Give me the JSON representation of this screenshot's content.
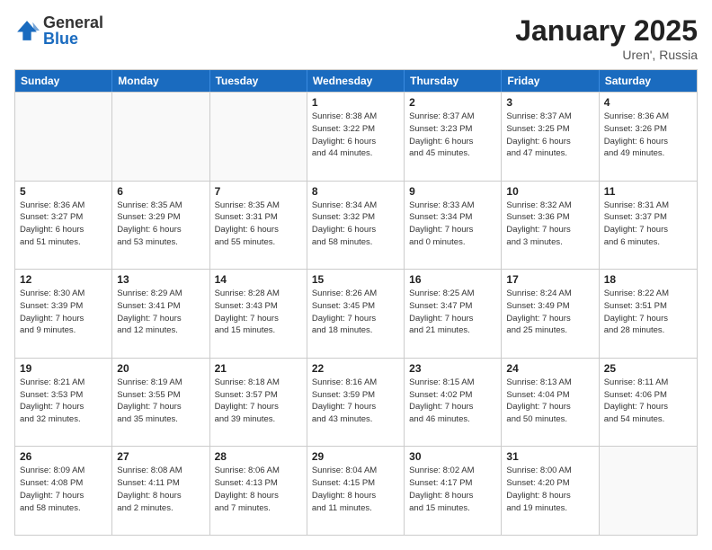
{
  "logo": {
    "general": "General",
    "blue": "Blue"
  },
  "header": {
    "month": "January 2025",
    "location": "Uren', Russia"
  },
  "weekdays": [
    "Sunday",
    "Monday",
    "Tuesday",
    "Wednesday",
    "Thursday",
    "Friday",
    "Saturday"
  ],
  "weeks": [
    [
      {
        "day": "",
        "info": ""
      },
      {
        "day": "",
        "info": ""
      },
      {
        "day": "",
        "info": ""
      },
      {
        "day": "1",
        "info": "Sunrise: 8:38 AM\nSunset: 3:22 PM\nDaylight: 6 hours\nand 44 minutes."
      },
      {
        "day": "2",
        "info": "Sunrise: 8:37 AM\nSunset: 3:23 PM\nDaylight: 6 hours\nand 45 minutes."
      },
      {
        "day": "3",
        "info": "Sunrise: 8:37 AM\nSunset: 3:25 PM\nDaylight: 6 hours\nand 47 minutes."
      },
      {
        "day": "4",
        "info": "Sunrise: 8:36 AM\nSunset: 3:26 PM\nDaylight: 6 hours\nand 49 minutes."
      }
    ],
    [
      {
        "day": "5",
        "info": "Sunrise: 8:36 AM\nSunset: 3:27 PM\nDaylight: 6 hours\nand 51 minutes."
      },
      {
        "day": "6",
        "info": "Sunrise: 8:35 AM\nSunset: 3:29 PM\nDaylight: 6 hours\nand 53 minutes."
      },
      {
        "day": "7",
        "info": "Sunrise: 8:35 AM\nSunset: 3:31 PM\nDaylight: 6 hours\nand 55 minutes."
      },
      {
        "day": "8",
        "info": "Sunrise: 8:34 AM\nSunset: 3:32 PM\nDaylight: 6 hours\nand 58 minutes."
      },
      {
        "day": "9",
        "info": "Sunrise: 8:33 AM\nSunset: 3:34 PM\nDaylight: 7 hours\nand 0 minutes."
      },
      {
        "day": "10",
        "info": "Sunrise: 8:32 AM\nSunset: 3:36 PM\nDaylight: 7 hours\nand 3 minutes."
      },
      {
        "day": "11",
        "info": "Sunrise: 8:31 AM\nSunset: 3:37 PM\nDaylight: 7 hours\nand 6 minutes."
      }
    ],
    [
      {
        "day": "12",
        "info": "Sunrise: 8:30 AM\nSunset: 3:39 PM\nDaylight: 7 hours\nand 9 minutes."
      },
      {
        "day": "13",
        "info": "Sunrise: 8:29 AM\nSunset: 3:41 PM\nDaylight: 7 hours\nand 12 minutes."
      },
      {
        "day": "14",
        "info": "Sunrise: 8:28 AM\nSunset: 3:43 PM\nDaylight: 7 hours\nand 15 minutes."
      },
      {
        "day": "15",
        "info": "Sunrise: 8:26 AM\nSunset: 3:45 PM\nDaylight: 7 hours\nand 18 minutes."
      },
      {
        "day": "16",
        "info": "Sunrise: 8:25 AM\nSunset: 3:47 PM\nDaylight: 7 hours\nand 21 minutes."
      },
      {
        "day": "17",
        "info": "Sunrise: 8:24 AM\nSunset: 3:49 PM\nDaylight: 7 hours\nand 25 minutes."
      },
      {
        "day": "18",
        "info": "Sunrise: 8:22 AM\nSunset: 3:51 PM\nDaylight: 7 hours\nand 28 minutes."
      }
    ],
    [
      {
        "day": "19",
        "info": "Sunrise: 8:21 AM\nSunset: 3:53 PM\nDaylight: 7 hours\nand 32 minutes."
      },
      {
        "day": "20",
        "info": "Sunrise: 8:19 AM\nSunset: 3:55 PM\nDaylight: 7 hours\nand 35 minutes."
      },
      {
        "day": "21",
        "info": "Sunrise: 8:18 AM\nSunset: 3:57 PM\nDaylight: 7 hours\nand 39 minutes."
      },
      {
        "day": "22",
        "info": "Sunrise: 8:16 AM\nSunset: 3:59 PM\nDaylight: 7 hours\nand 43 minutes."
      },
      {
        "day": "23",
        "info": "Sunrise: 8:15 AM\nSunset: 4:02 PM\nDaylight: 7 hours\nand 46 minutes."
      },
      {
        "day": "24",
        "info": "Sunrise: 8:13 AM\nSunset: 4:04 PM\nDaylight: 7 hours\nand 50 minutes."
      },
      {
        "day": "25",
        "info": "Sunrise: 8:11 AM\nSunset: 4:06 PM\nDaylight: 7 hours\nand 54 minutes."
      }
    ],
    [
      {
        "day": "26",
        "info": "Sunrise: 8:09 AM\nSunset: 4:08 PM\nDaylight: 7 hours\nand 58 minutes."
      },
      {
        "day": "27",
        "info": "Sunrise: 8:08 AM\nSunset: 4:11 PM\nDaylight: 8 hours\nand 2 minutes."
      },
      {
        "day": "28",
        "info": "Sunrise: 8:06 AM\nSunset: 4:13 PM\nDaylight: 8 hours\nand 7 minutes."
      },
      {
        "day": "29",
        "info": "Sunrise: 8:04 AM\nSunset: 4:15 PM\nDaylight: 8 hours\nand 11 minutes."
      },
      {
        "day": "30",
        "info": "Sunrise: 8:02 AM\nSunset: 4:17 PM\nDaylight: 8 hours\nand 15 minutes."
      },
      {
        "day": "31",
        "info": "Sunrise: 8:00 AM\nSunset: 4:20 PM\nDaylight: 8 hours\nand 19 minutes."
      },
      {
        "day": "",
        "info": ""
      }
    ]
  ]
}
